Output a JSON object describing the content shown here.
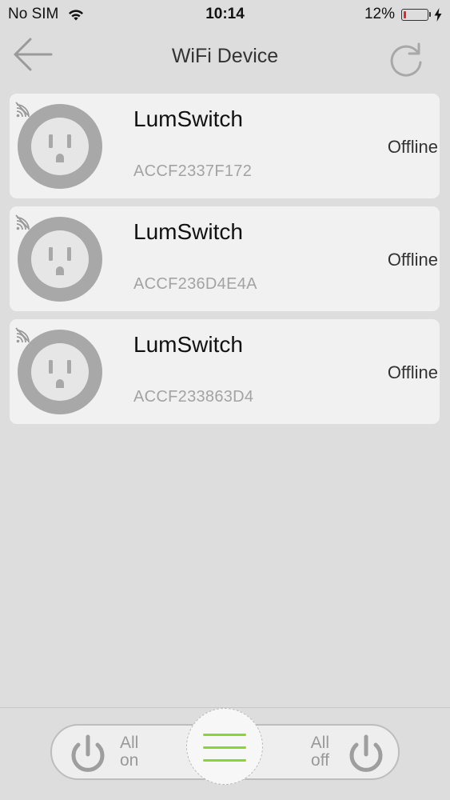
{
  "status_bar": {
    "carrier": "No SIM",
    "time": "10:14",
    "battery_percent": "12%",
    "battery_level": 0.12,
    "battery_color": "#e4262c",
    "icons": [
      "wifi-icon",
      "battery-icon",
      "charging-bolt-icon"
    ]
  },
  "nav": {
    "title": "WiFi Device",
    "back_icon": "back-arrow-icon",
    "refresh_icon": "refresh-icon"
  },
  "devices": [
    {
      "name": "LumSwitch",
      "id": "ACCF2337F172",
      "status": "Offline"
    },
    {
      "name": "LumSwitch",
      "id": "ACCF236D4E4A",
      "status": "Offline"
    },
    {
      "name": "LumSwitch",
      "id": "ACCF233863D4",
      "status": "Offline"
    }
  ],
  "bottom_bar": {
    "all_on": {
      "line1": "All",
      "line2": "on"
    },
    "all_off": {
      "line1": "All",
      "line2": "off"
    },
    "menu_icon": "hamburger-menu-icon",
    "menu_color": "#8fd13b"
  }
}
